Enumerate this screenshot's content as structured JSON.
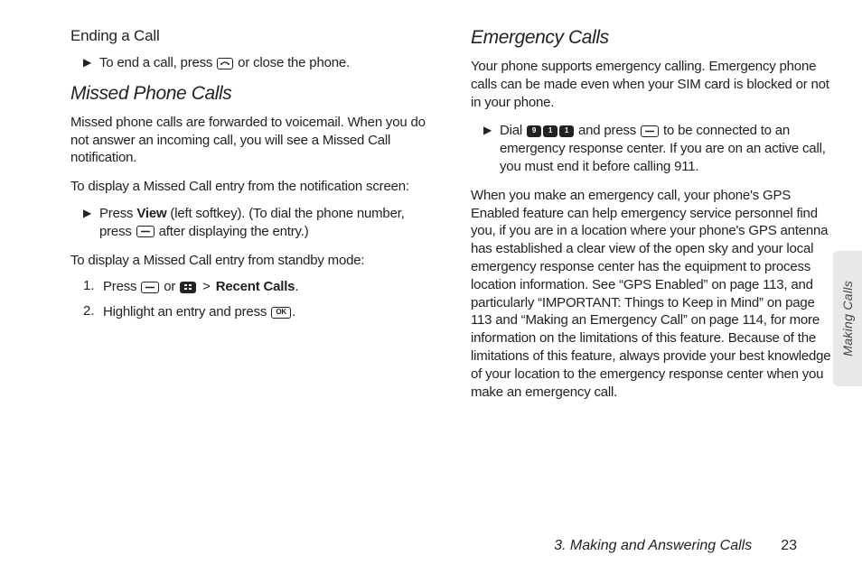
{
  "left": {
    "ending": {
      "heading": "Ending a Call",
      "bullet": "To end a call, press ",
      "bullet_after": " or close the phone."
    },
    "missed": {
      "heading": "Missed Phone Calls",
      "para1": "Missed phone calls are forwarded to voicemail. When you do not answer an incoming call, you will see a Missed Call notification.",
      "intro1": "To display a Missed Call entry from the notification screen:",
      "bullet_pre": "Press ",
      "bullet_view": "View",
      "bullet_mid": " (left softkey). (To dial the phone number, press ",
      "bullet_after": " after displaying the entry.)",
      "intro2": "To display a Missed Call entry from standby mode:",
      "step1_pre": "Press ",
      "step1_or": " or ",
      "step1_gt": " > ",
      "step1_recent": "Recent Calls",
      "step1_after": ".",
      "step2_pre": "Highlight an entry and press ",
      "step2_after": "."
    }
  },
  "right": {
    "emergency": {
      "heading": "Emergency Calls",
      "para1": "Your phone supports emergency calling. Emergency phone calls can be made even when your SIM card is blocked or not in your phone.",
      "bullet_pre": "Dial ",
      "bullet_mid": " and press ",
      "bullet_after": " to be connected to an emergency response center. If you are on an active call, you must end it before calling 911.",
      "para2": "When you make an emergency call, your phone's GPS Enabled feature can help emergency service personnel find you, if you are in a location where your phone's GPS antenna has established a clear view of the open sky and your local emergency response center has the equipment to process location information. See “GPS Enabled” on page 113, and particularly “IMPORTANT: Things to Keep in Mind” on page 113 and “Making an Emergency Call” on page 114, for more information on the limitations of this feature. Because of the limitations of this feature, always provide your best knowledge of your location to the emergency response center when you make an emergency call."
    }
  },
  "icons": {
    "end_key": "⌕",
    "send_key": "—",
    "menu_key": "∷",
    "ok_key": "OK",
    "key9": "9",
    "key1a": "1",
    "key1b": "1"
  },
  "sidetab": "Making Calls",
  "footer": {
    "chapter": "3. Making and Answering Calls",
    "page": "23"
  }
}
